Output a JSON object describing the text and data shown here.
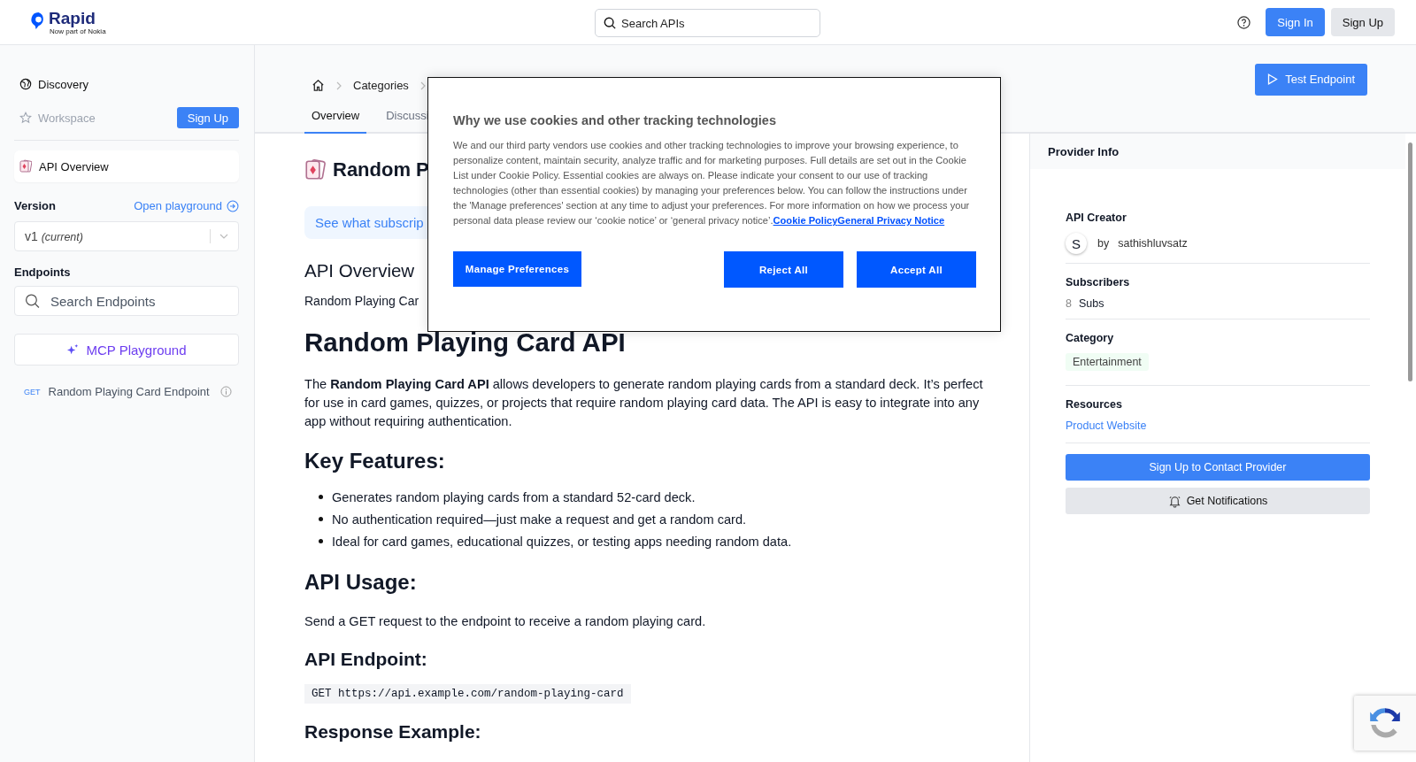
{
  "header": {
    "logo": "Rapid",
    "logo_tagline": "Now part of Nokia",
    "search": {
      "placeholder": "Search APIs"
    },
    "buttons": [
      {
        "label": "Sign In",
        "kind": "primary"
      },
      {
        "label": "Sign Up",
        "kind": "secondary"
      }
    ]
  },
  "sidebar": {
    "nav": [
      {
        "label": "Discovery",
        "disabled": false
      },
      {
        "label": "Workspace",
        "disabled": true
      }
    ],
    "signup_button": "Sign Up",
    "overview_item": {
      "label": "API Overview",
      "selected": true
    },
    "version_label": "Version",
    "playground_link": "Open playground",
    "version_select": {
      "value": "v1",
      "note": "(current)"
    },
    "endpoints_label": "Endpoints",
    "endpoints_search": {
      "placeholder": "Search Endpoints"
    },
    "mcp_button": "MCP Playground",
    "endpoints": [
      {
        "method": "GET",
        "name": "Random Playing Card Endpoint"
      }
    ]
  },
  "main": {
    "breadcrumb": [
      "Categories"
    ],
    "test_button": "Test Endpoint",
    "tabs": [
      {
        "label": "Overview",
        "selected": true
      },
      {
        "label": "Discussi",
        "selected": false
      }
    ],
    "title": "Random P",
    "subscription_banner": "See what subscrip",
    "section_heading": "API Overview",
    "section_text": "Random Playing Car",
    "content": [
      {
        "kind": "h1",
        "text": "Random Playing Card API"
      },
      {
        "kind": "p",
        "text": "The **Random Playing Card API** allows developers to generate random playing cards from a standard deck. It’s perfect for use in card games, quizzes, or projects that require random playing card data. The API is easy to integrate into any app without requiring authentication."
      },
      {
        "kind": "h2",
        "text": "Key Features:"
      },
      {
        "kind": "list",
        "items": [
          "Generates random playing cards from a standard 52-card deck.",
          "No authentication required—just make a request and get a random card.",
          "Ideal for card games, educational quizzes, or testing apps needing random data."
        ]
      },
      {
        "kind": "h2",
        "text": "API Usage:"
      },
      {
        "kind": "p",
        "text": "Send a GET request to the endpoint to receive a random playing card."
      },
      {
        "kind": "h3",
        "text": "API Endpoint:"
      },
      {
        "kind": "code",
        "text": "GET https://api.example.com/random-playing-card"
      },
      {
        "kind": "h3",
        "text": "Response Example:"
      }
    ]
  },
  "provider": {
    "title": "Provider Info",
    "creator_label": "API Creator",
    "creator_initial": "S",
    "creator_prefix": "by",
    "creator_name": "sathishluvsatz",
    "subscribers_label": "Subscribers",
    "subscribers_count": "8",
    "subscribers_unit": "Subs",
    "category_label": "Category",
    "category": "Entertainment",
    "resources_label": "Resources",
    "resource_link": "Product Website",
    "contact_button": "Sign Up to Contact Provider",
    "notify_button": "Get Notifications"
  },
  "cookie_dialog": {
    "title": "Why we use cookies and other tracking technologies",
    "body": "We and our third party vendors use cookies and other tracking technologies to improve your browsing experience, to personalize content, maintain security, analyze traffic and for marketing purposes. Full details are set out in the Cookie List under Cookie Policy. Essential cookies are always on. Please indicate your consent to our use of tracking technologies (other than essential cookies) by managing your preferences below. You can follow the instructions under the 'Manage preferences' section at any time to adjust your preferences. For more information on how we process your personal data please review our ‘cookie notice’ or ‘general privacy notice’.",
    "links": [
      "Cookie Policy",
      "General Privacy Notice"
    ],
    "buttons": [
      "Manage Preferences",
      "Reject All",
      "Accept All"
    ]
  }
}
